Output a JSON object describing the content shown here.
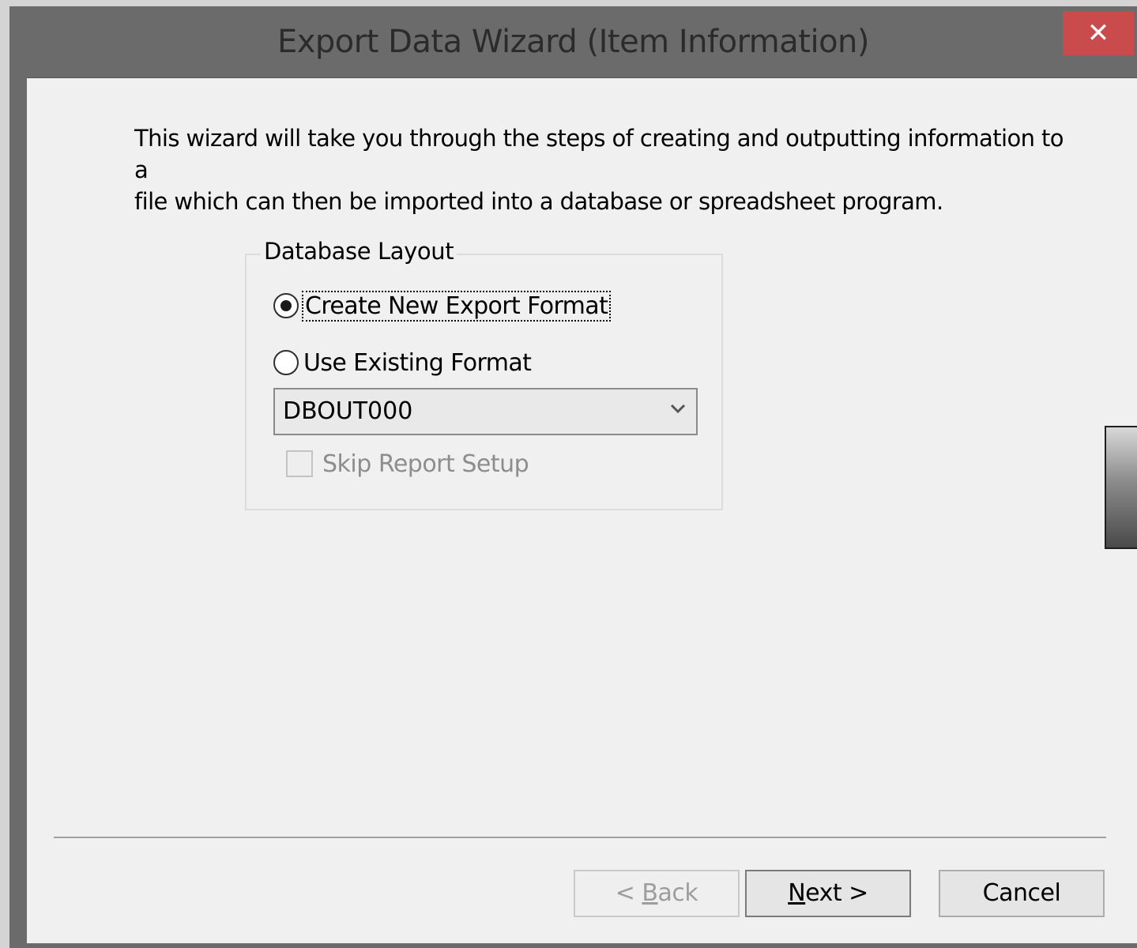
{
  "window": {
    "title": "Export Data Wizard (Item Information)",
    "close_symbol": "✕"
  },
  "intro": {
    "line1": "This wizard will take you through the steps of creating and outputting information to a",
    "line2": "file which can then be imported into a database or spreadsheet program."
  },
  "database_layout": {
    "legend": "Database Layout",
    "option_create": {
      "label": "Create New Export Format",
      "selected": true
    },
    "option_existing": {
      "label": "Use Existing Format",
      "selected": false
    },
    "format_select": {
      "value": "DBOUT000",
      "arrow_icon": "chevron-down-icon"
    },
    "skip_report_setup": {
      "label": "Skip Report Setup",
      "checked": false,
      "enabled": false
    }
  },
  "buttons": {
    "back": {
      "prefix": "< ",
      "mnemonic": "B",
      "rest": "ack",
      "enabled": false
    },
    "next": {
      "prefix": "",
      "mnemonic": "N",
      "rest": "ext >",
      "enabled": true
    },
    "cancel": {
      "label": "Cancel",
      "enabled": true
    }
  },
  "colors": {
    "titlebar": "#6b6b6b",
    "close_button": "#c94b4b",
    "client": "#f0f0f0"
  }
}
